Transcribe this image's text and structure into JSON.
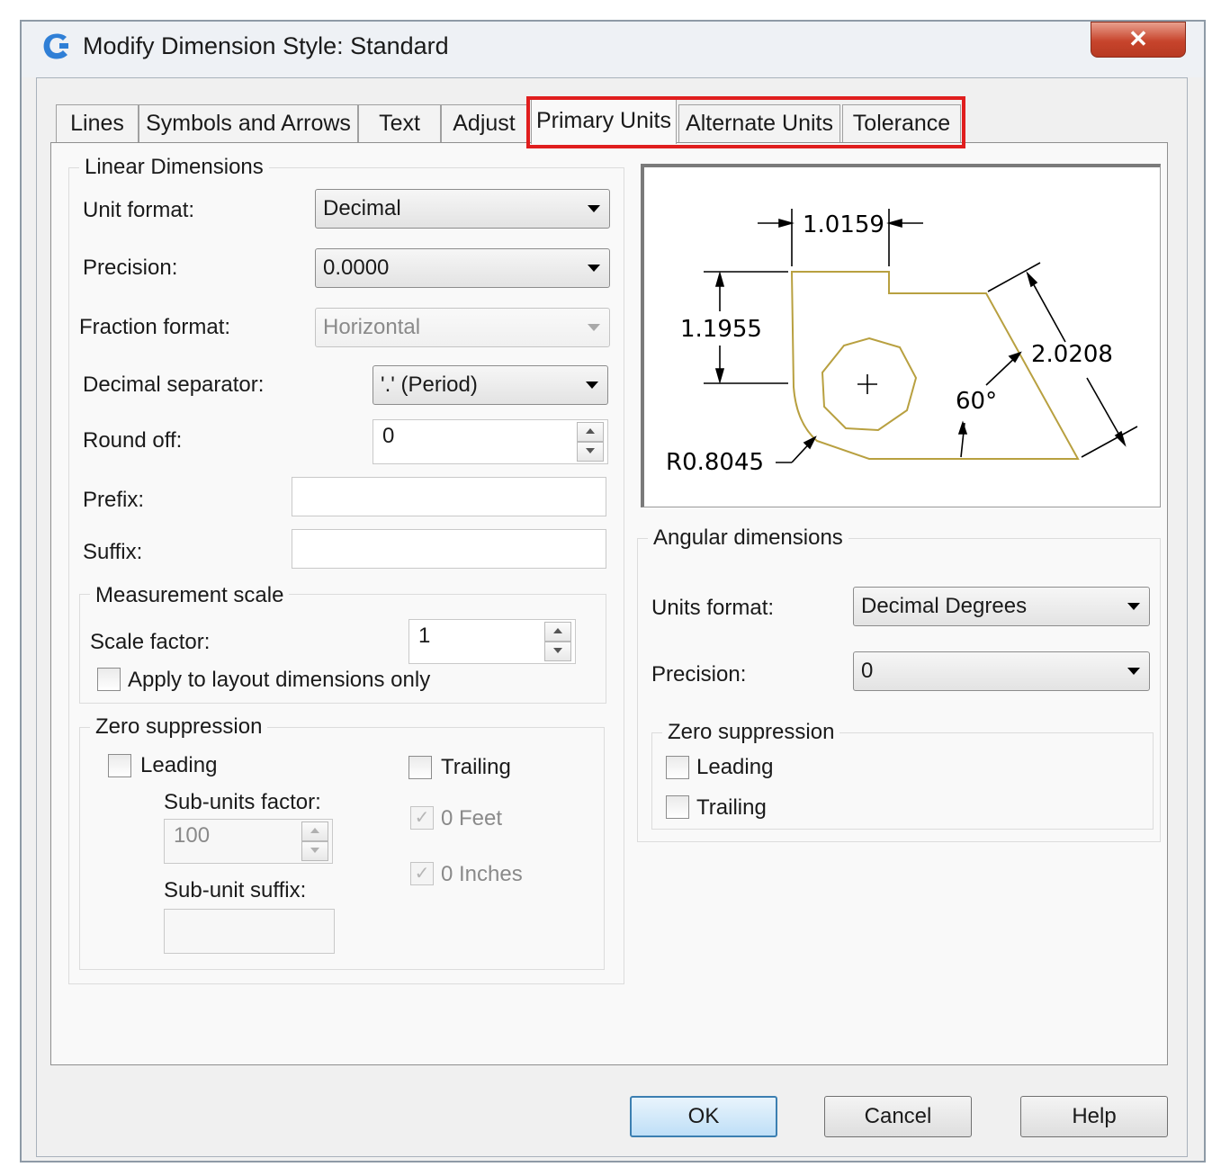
{
  "window": {
    "title": "Modify Dimension Style: Standard",
    "close_glyph": "✕"
  },
  "tabs": [
    {
      "label": "Lines",
      "active": false
    },
    {
      "label": "Symbols and Arrows",
      "active": false
    },
    {
      "label": "Text",
      "active": false
    },
    {
      "label": "Adjust",
      "active": false
    },
    {
      "label": "Primary Units",
      "active": true
    },
    {
      "label": "Alternate Units",
      "active": false
    },
    {
      "label": "Tolerance",
      "active": false
    }
  ],
  "linear": {
    "title": "Linear Dimensions",
    "unit_format_label": "Unit format:",
    "unit_format_value": "Decimal",
    "precision_label": "Precision:",
    "precision_value": "0.0000",
    "fraction_format_label": "Fraction format:",
    "fraction_format_value": "Horizontal",
    "decimal_separator_label": "Decimal separator:",
    "decimal_separator_value": "'.' (Period)",
    "round_off_label": "Round off:",
    "round_off_value": "0",
    "prefix_label": "Prefix:",
    "prefix_value": "",
    "suffix_label": "Suffix:",
    "suffix_value": ""
  },
  "measurement_scale": {
    "title": "Measurement scale",
    "scale_factor_label": "Scale factor:",
    "scale_factor_value": "1",
    "apply_layout_label": "Apply to layout dimensions only"
  },
  "linear_zero_suppression": {
    "title": "Zero suppression",
    "leading_label": "Leading",
    "trailing_label": "Trailing",
    "subunits_factor_label": "Sub-units factor:",
    "subunits_factor_value": "100",
    "subunit_suffix_label": "Sub-unit suffix:",
    "subunit_suffix_value": "",
    "feet_label": "0 Feet",
    "inches_label": "0 Inches",
    "disabled_check_glyph": "✓"
  },
  "preview": {
    "dim_top": "1.0159",
    "dim_left": "1.1955",
    "dim_diag": "2.0208",
    "dim_angle": "60°",
    "dim_radius": "R0.8045",
    "colors": {
      "geometry": "#b8a040",
      "dimension": "#000000"
    }
  },
  "angular": {
    "title": "Angular dimensions",
    "units_format_label": "Units format:",
    "units_format_value": "Decimal Degrees",
    "precision_label": "Precision:",
    "precision_value": "0"
  },
  "angular_zero_suppression": {
    "title": "Zero suppression",
    "leading_label": "Leading",
    "trailing_label": "Trailing"
  },
  "buttons": {
    "ok": "OK",
    "cancel": "Cancel",
    "help": "Help"
  },
  "colors": {
    "highlight": "#e01e1e",
    "default_button_border": "#3c7fb1",
    "close_button": "#c7442c"
  }
}
